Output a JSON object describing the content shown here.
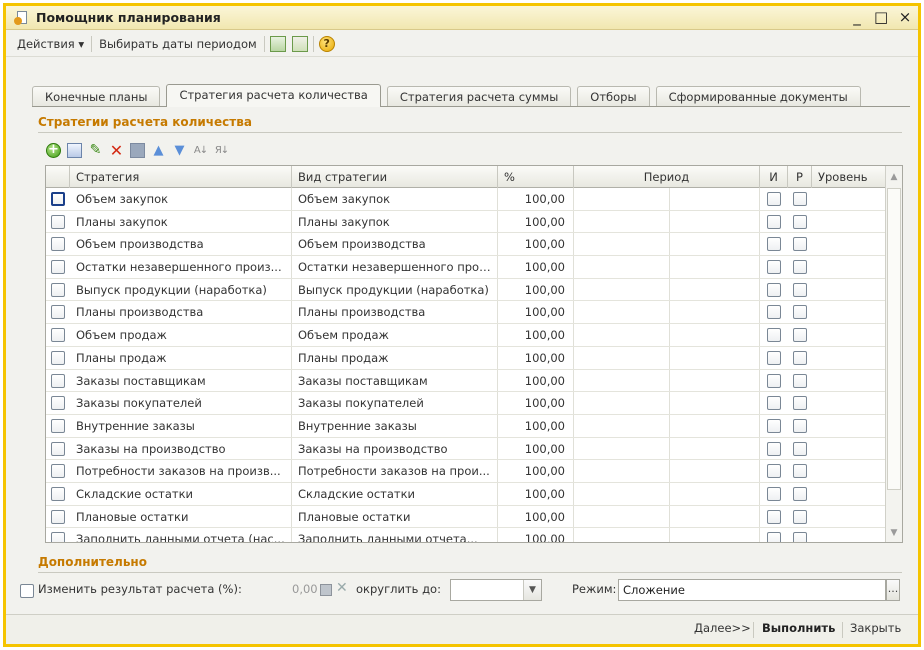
{
  "window": {
    "title": "Помощник планирования",
    "icon": "document-star-icon",
    "controls": {
      "minimize": "_",
      "maximize": "□",
      "close": "×"
    }
  },
  "toolbar": {
    "actions_label": "Действия ▾",
    "select_dates_label": "Выбирать даты периодом",
    "icons": [
      "calendar-export-icon",
      "calendar-import-icon",
      "help-icon"
    ],
    "help_glyph": "?"
  },
  "tabs": [
    {
      "label": "Конечные планы",
      "active": false
    },
    {
      "label": "Стратегия расчета количества",
      "active": true
    },
    {
      "label": "Стратегия расчета суммы",
      "active": false
    },
    {
      "label": "Отборы",
      "active": false
    },
    {
      "label": "Сформированные документы",
      "active": false
    }
  ],
  "strategies": {
    "section_title": "Стратегии расчета количества",
    "columns": {
      "strategy": "Стратегия",
      "kind": "Вид стратегии",
      "percent": "%",
      "period": "Период",
      "i": "И",
      "r": "Р",
      "level": "Уровень"
    },
    "rows": [
      {
        "strategy": "Объем закупок",
        "kind": "Объем закупок",
        "percent": "100,00"
      },
      {
        "strategy": "Планы закупок",
        "kind": "Планы закупок",
        "percent": "100,00"
      },
      {
        "strategy": "Объем производства",
        "kind": "Объем производства",
        "percent": "100,00"
      },
      {
        "strategy": "Остатки незавершенного произ...",
        "kind": "Остатки незавершенного прои...",
        "percent": "100,00"
      },
      {
        "strategy": "Выпуск продукции (наработка)",
        "kind": "Выпуск продукции (наработка)",
        "percent": "100,00"
      },
      {
        "strategy": "Планы производства",
        "kind": "Планы производства",
        "percent": "100,00"
      },
      {
        "strategy": "Объем продаж",
        "kind": "Объем продаж",
        "percent": "100,00"
      },
      {
        "strategy": "Планы продаж",
        "kind": "Планы продаж",
        "percent": "100,00"
      },
      {
        "strategy": "Заказы поставщикам",
        "kind": "Заказы поставщикам",
        "percent": "100,00"
      },
      {
        "strategy": "Заказы покупателей",
        "kind": "Заказы покупателей",
        "percent": "100,00"
      },
      {
        "strategy": "Внутренние заказы",
        "kind": "Внутренние заказы",
        "percent": "100,00"
      },
      {
        "strategy": "Заказы на производство",
        "kind": "Заказы на производство",
        "percent": "100,00"
      },
      {
        "strategy": "Потребности заказов на произв...",
        "kind": "Потребности заказов на прои...",
        "percent": "100,00"
      },
      {
        "strategy": "Складские остатки",
        "kind": "Складские остатки",
        "percent": "100,00"
      },
      {
        "strategy": "Плановые остатки",
        "kind": "Плановые остатки",
        "percent": "100,00"
      },
      {
        "strategy": "Заполнить данными отчета (нас...",
        "kind": "Заполнить данными отчета...",
        "percent": "100,00"
      }
    ]
  },
  "additional": {
    "section_title": "Дополнительно",
    "change_result_label": "Изменить результат расчета (%):",
    "change_value": "0,00",
    "round_label": "округлить до:",
    "round_value": "",
    "mode_label": "Режим:",
    "mode_value": "Сложение",
    "mode_button": "..."
  },
  "footer": {
    "next": "Далее>>",
    "run": "Выполнить",
    "close": "Закрыть"
  }
}
